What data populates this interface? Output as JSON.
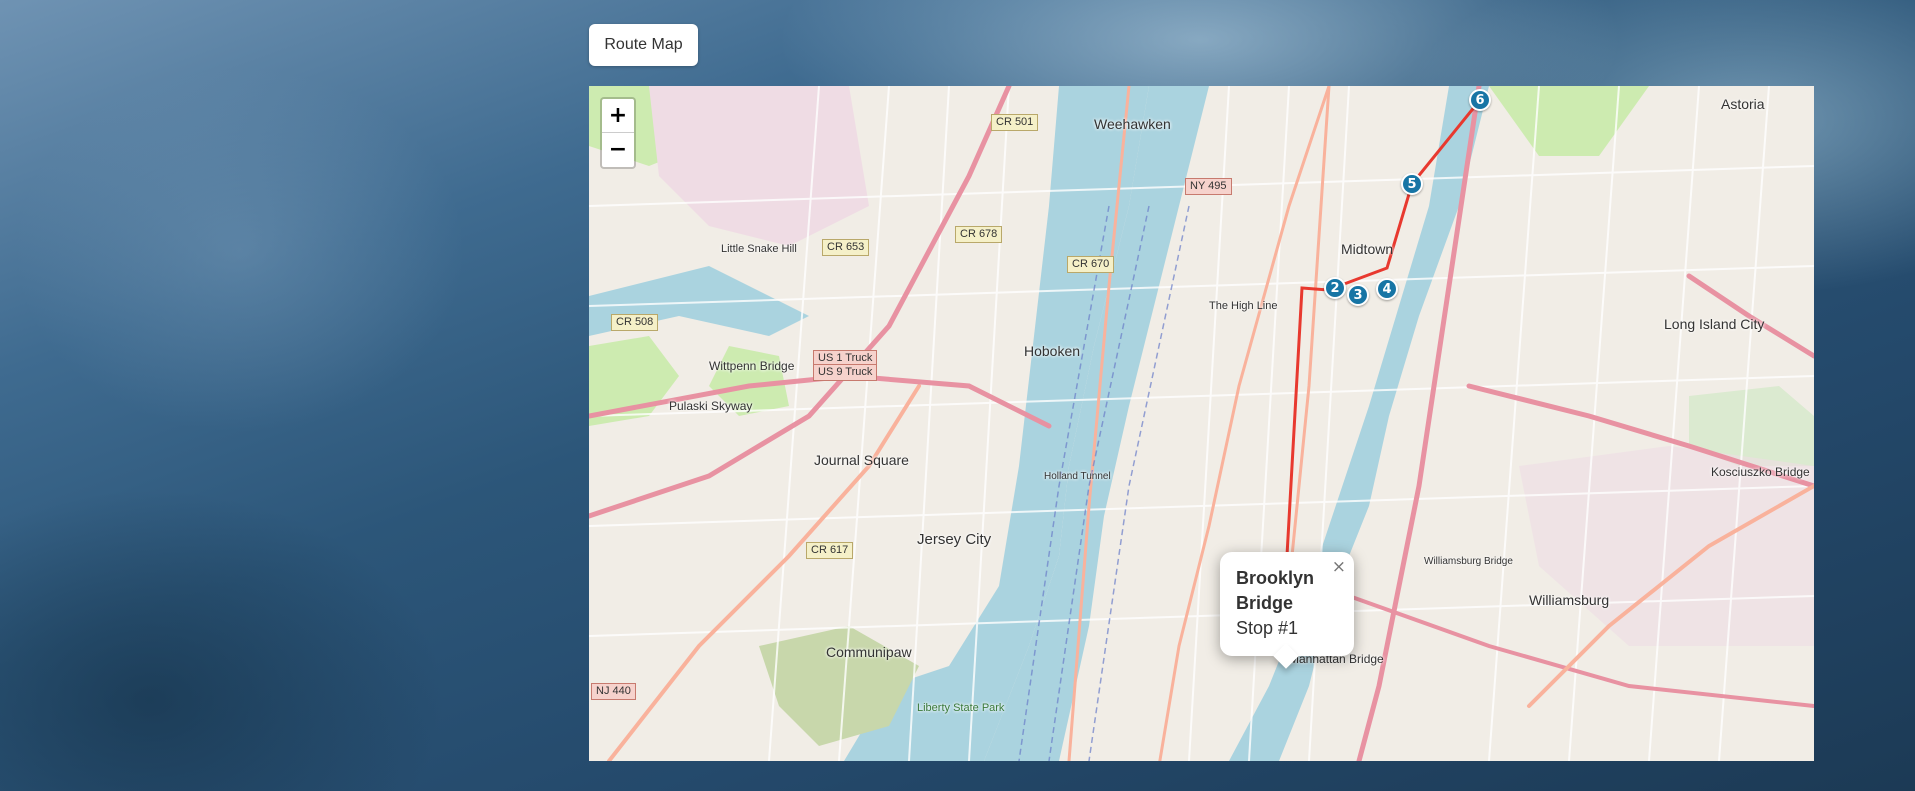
{
  "route_button": {
    "label": "Route Map"
  },
  "zoom": {
    "in_label": "+",
    "out_label": "−"
  },
  "map_labels": {
    "weehawken": "Weehawken",
    "hoboken": "Hoboken",
    "midtown": "Midtown",
    "astoria": "Astoria",
    "long_island_city": "Long Island City",
    "journal_square": "Journal Square",
    "jersey_city": "Jersey City",
    "communipaw": "Communipaw",
    "williamsburg": "Williamsburg",
    "wittpenn_bridge": "Wittpenn Bridge",
    "pulaski_skyway": "Pulaski Skyway",
    "little_snake_hill": "Little Snake Hill",
    "kosciuszko_bridge": "Kosciuszko Bridge",
    "manhattan_bridge": "Manhattan Bridge",
    "the_high_line": "The High Line",
    "liberty_state_park": "Liberty State Park",
    "holland_tunnel": "Holland Tunnel",
    "williamsburg_bridge": "Williamsburg Bridge"
  },
  "road_shields": {
    "cr501": "CR 501",
    "ny495": "NY 495",
    "cr678": "CR 678",
    "cr653": "CR 653",
    "cr670": "CR 670",
    "cr508": "CR 508",
    "us1": "US 1 Truck",
    "us9": "US 9 Truck",
    "cr617": "CR 617",
    "nj440": "NJ 440"
  },
  "route": {
    "line_color": "#e8392f",
    "marker_color": "#1775a5",
    "stops": [
      {
        "number": "1",
        "name": "Brooklyn Bridge"
      },
      {
        "number": "2"
      },
      {
        "number": "3"
      },
      {
        "number": "4"
      },
      {
        "number": "5"
      },
      {
        "number": "6"
      }
    ]
  },
  "popup": {
    "title": "Brooklyn Bridge",
    "subtitle": "Stop #1",
    "close_label": "×"
  }
}
